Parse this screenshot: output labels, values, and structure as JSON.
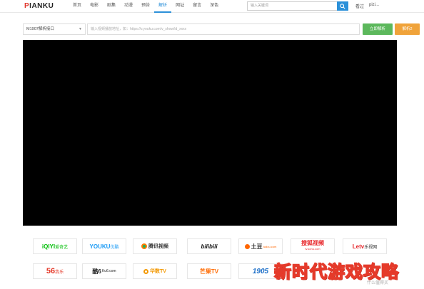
{
  "header": {
    "logo": "PIANKU",
    "nav": [
      "首页",
      "电影",
      "剧集",
      "动漫",
      "预告",
      "解析",
      "网址",
      "留言",
      "深色"
    ],
    "active_nav": "解析",
    "search_placeholder": "输入关键词",
    "history_label": "看过",
    "user_label": "pizi..."
  },
  "parse": {
    "interface_select": "M1907解析接口",
    "url_placeholder": "输入视频播放地址，如：https://v.youku.com/v_show/id_xxxx",
    "parse_button": "立即解析",
    "other_button": "解析2"
  },
  "platforms": {
    "row1": [
      {
        "name": "iQIYI",
        "sub": "爱奇艺",
        "color": "#00be06"
      },
      {
        "name": "YOUKU",
        "sub": "优酷",
        "color": "#1a9af5"
      },
      {
        "name": "腾讯视频",
        "sub": "",
        "color": "#ff7a00"
      },
      {
        "name": "bilibili",
        "sub": "",
        "color": "#111111"
      },
      {
        "name": "土豆",
        "sub": "tudou.com",
        "color": "#ff6600"
      },
      {
        "name": "搜狐视频",
        "sub": "tv.sohu.com",
        "color": "#e8262a"
      },
      {
        "name": "Letv",
        "sub": "乐视网",
        "color": "#e4262b"
      }
    ],
    "row2": [
      {
        "name": "56",
        "sub": "我乐",
        "color": "#e53a2a"
      },
      {
        "name": "酷6",
        "sub": "Ku6.com",
        "color": "#222222"
      },
      {
        "name": "华数TV",
        "sub": "",
        "color": "#f39800"
      },
      {
        "name": "芒果TV",
        "sub": "",
        "color": "#ff6a00"
      },
      {
        "name": "1905",
        "sub": "",
        "color": "#1c6fc8"
      }
    ]
  },
  "watermark": "新时代游戏攻略",
  "watermark_small": "什么值得买"
}
